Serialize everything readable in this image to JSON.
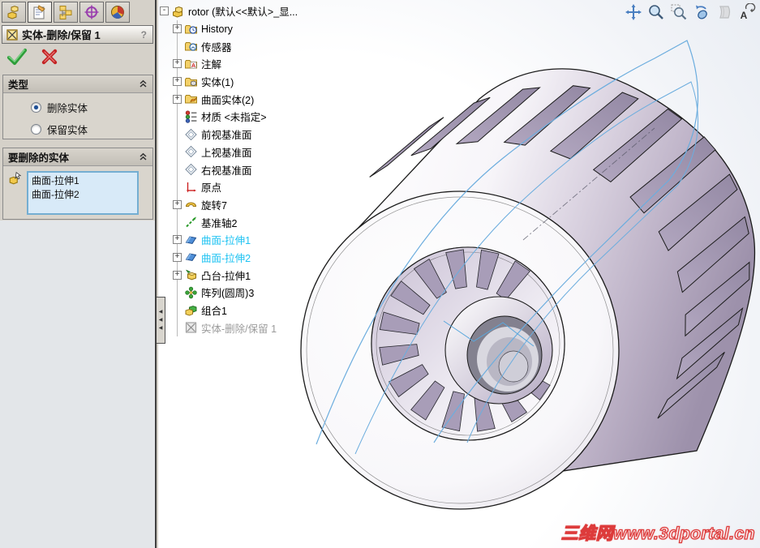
{
  "property_manager": {
    "title": "实体-删除/保留 1",
    "help_label": "?",
    "tabs": [
      {
        "icon": "featuremanager-tab-icon",
        "active": false
      },
      {
        "icon": "propertymanager-tab-icon",
        "active": true
      },
      {
        "icon": "configurationmanager-tab-icon",
        "active": false
      },
      {
        "icon": "dimxpertmanager-tab-icon",
        "active": false
      },
      {
        "icon": "displaymanager-tab-icon",
        "active": false
      }
    ],
    "groups": {
      "type": {
        "header": "类型",
        "options": [
          {
            "label": "删除实体",
            "selected": true
          },
          {
            "label": "保留实体",
            "selected": false
          }
        ]
      },
      "bodies": {
        "header": "要删除的实体",
        "items": [
          "曲面-拉伸1",
          "曲面-拉伸2"
        ]
      }
    }
  },
  "feature_tree": {
    "collapse_glyph": "-",
    "expand_glyph": "+",
    "root": {
      "label": "rotor (默认<<默认>_显...",
      "icon": "part-icon"
    },
    "items": [
      {
        "label": "History",
        "icon": "history-folder-icon",
        "expandable": true
      },
      {
        "label": "传感器",
        "icon": "sensors-folder-icon",
        "expandable": false
      },
      {
        "label": "注解",
        "icon": "annotations-folder-icon",
        "expandable": true
      },
      {
        "label": "实体(1)",
        "icon": "solid-bodies-folder-icon",
        "expandable": true
      },
      {
        "label": "曲面实体(2)",
        "icon": "surface-bodies-folder-icon",
        "expandable": true
      },
      {
        "label": "材质 <未指定>",
        "icon": "material-icon",
        "expandable": false
      },
      {
        "label": "前视基准面",
        "icon": "plane-icon",
        "expandable": false
      },
      {
        "label": "上视基准面",
        "icon": "plane-icon",
        "expandable": false
      },
      {
        "label": "右视基准面",
        "icon": "plane-icon",
        "expandable": false
      },
      {
        "label": "原点",
        "icon": "origin-icon",
        "expandable": false
      },
      {
        "label": "旋转7",
        "icon": "revolve-icon",
        "expandable": true
      },
      {
        "label": "基准轴2",
        "icon": "axis-icon",
        "expandable": false
      },
      {
        "label": "曲面-拉伸1",
        "icon": "surface-extrude-icon",
        "expandable": true,
        "highlighted": true
      },
      {
        "label": "曲面-拉伸2",
        "icon": "surface-extrude-icon",
        "expandable": true,
        "highlighted": true
      },
      {
        "label": "凸台-拉伸1",
        "icon": "boss-extrude-icon",
        "expandable": true
      },
      {
        "label": "阵列(圆周)3",
        "icon": "circular-pattern-icon",
        "expandable": false
      },
      {
        "label": "组合1",
        "icon": "combine-icon",
        "expandable": false
      },
      {
        "label": "实体-删除/保留 1",
        "icon": "body-delete-icon",
        "expandable": false,
        "pending": true
      }
    ]
  },
  "view_toolbar": {
    "buttons": [
      {
        "icon": "pan-icon",
        "disabled": false
      },
      {
        "icon": "zoom-icon",
        "disabled": false
      },
      {
        "icon": "zoom-to-area-icon",
        "disabled": false
      },
      {
        "icon": "rotate-view-icon",
        "disabled": false
      },
      {
        "icon": "section-view-icon",
        "disabled": true
      },
      {
        "icon": "view-orientation-icon",
        "disabled": false
      }
    ]
  },
  "watermark": {
    "text": "三维网www.3dportal.cn"
  },
  "colors": {
    "tree_highlight": "#1cc2f2",
    "panel_bg": "#d5d1c9",
    "panel_lower_bg": "#e3e6e9",
    "group_header_bg": "#cdc9c1",
    "listbox_bg": "#d8eaf8",
    "listbox_border": "#74aed2",
    "model_body_tint": "#a89db4",
    "wireframe_blue": "#6cadde",
    "watermark_red": "#dd3b3b",
    "ok_green": "#2e9e3a",
    "cancel_red": "#cc2222"
  }
}
